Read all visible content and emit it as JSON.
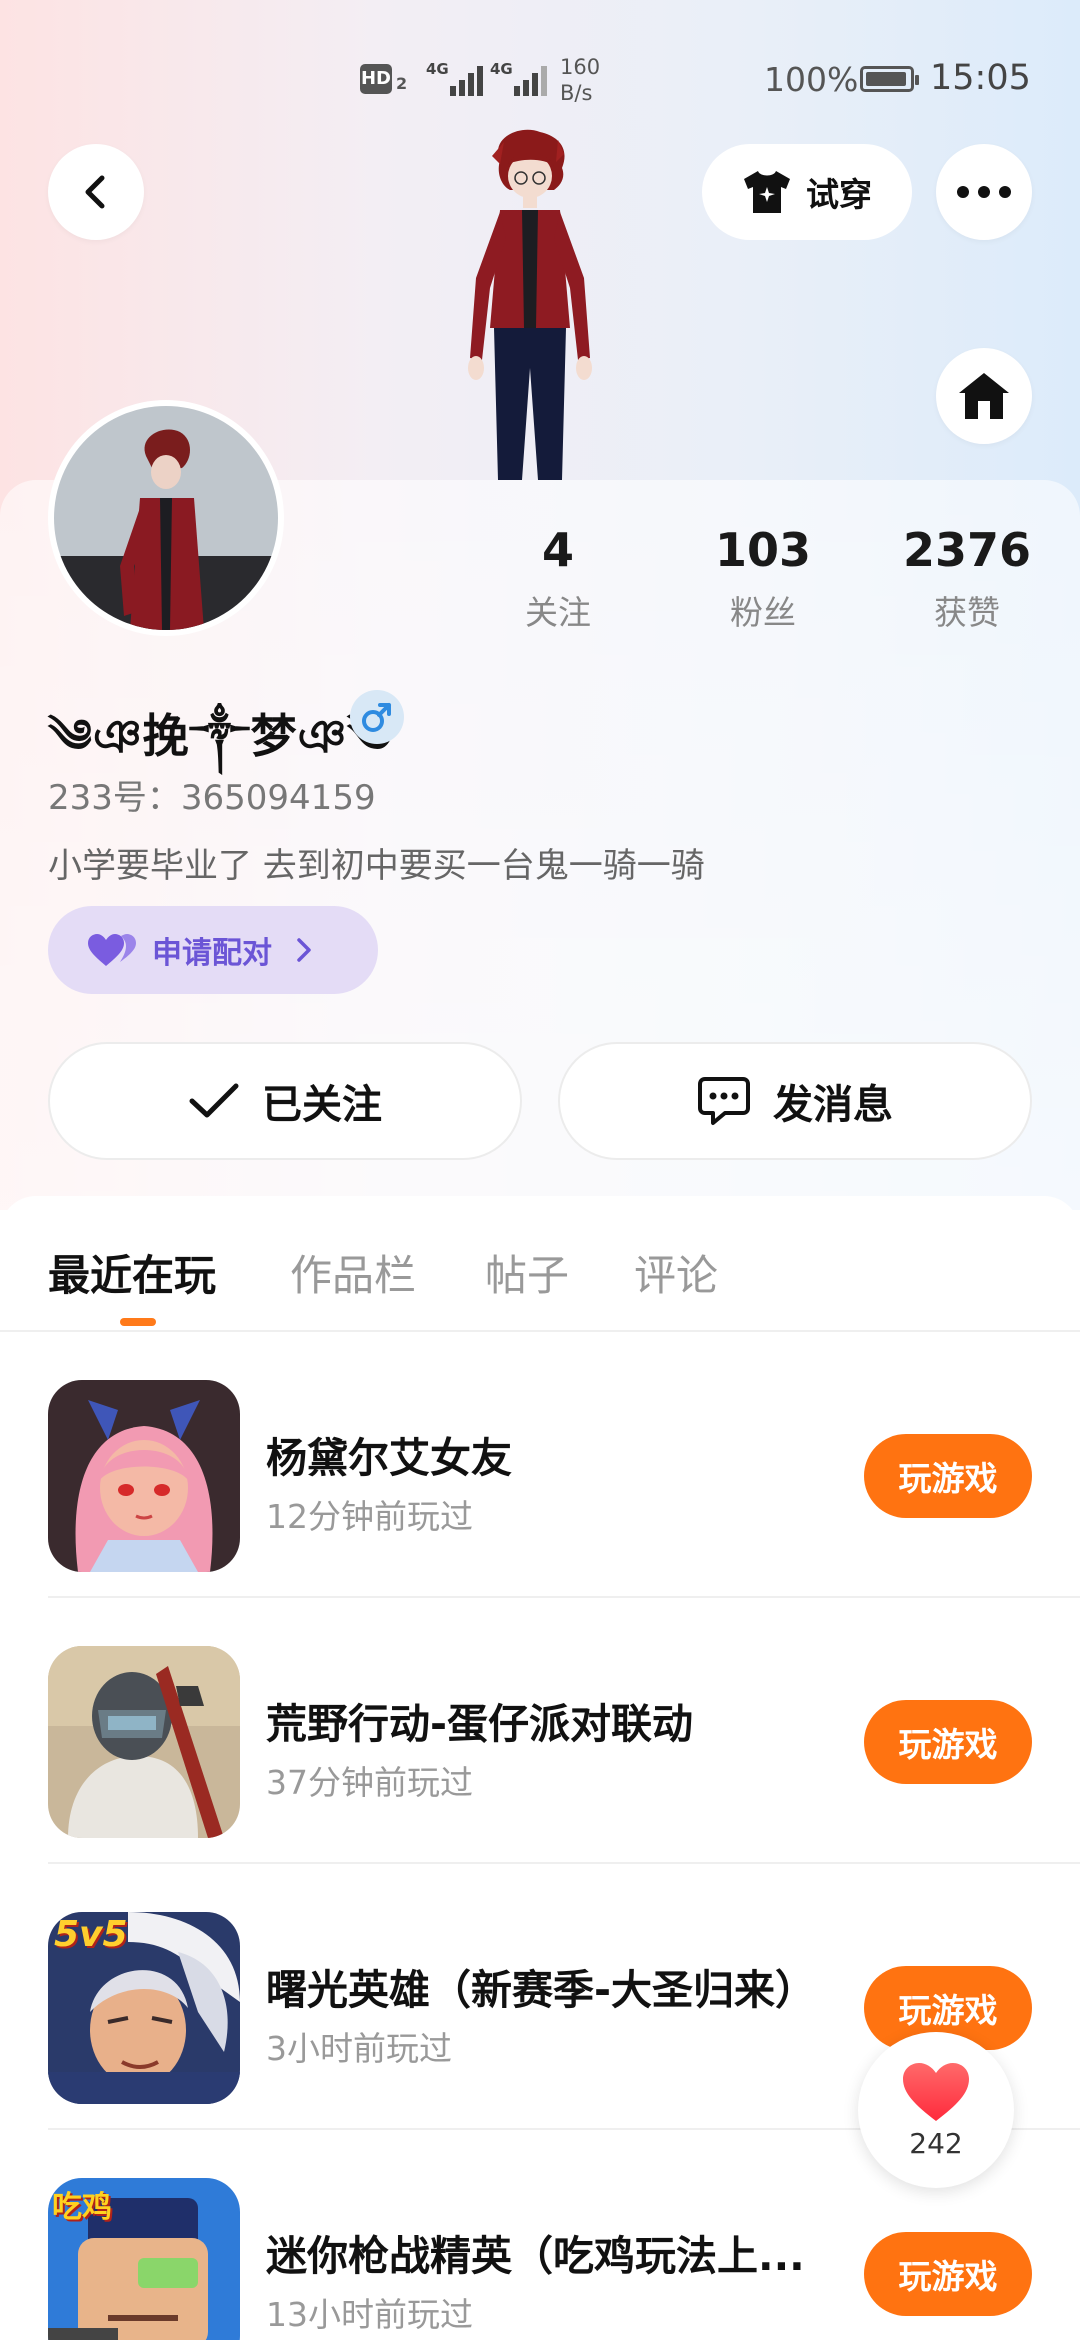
{
  "status_bar": {
    "hd": "HD",
    "hd_sub": "2",
    "net1": "4G",
    "net2": "4G",
    "speed_value": "160",
    "speed_unit": "B/s",
    "battery": "100%",
    "time": "15:05"
  },
  "header": {
    "back_icon": "chevron-left-icon",
    "try_on_label": "试穿",
    "try_on_icon": "shirt-icon",
    "more_icon": "more-dots-icon",
    "home_icon": "house-icon"
  },
  "profile": {
    "stats": [
      {
        "value": "4",
        "label": "关注"
      },
      {
        "value": "103",
        "label": "粉丝"
      },
      {
        "value": "2376",
        "label": "获赞"
      }
    ],
    "nickname": "༄ঞ挽༒梦ঞ༄",
    "gender_icon": "male-icon",
    "uid": "233号：365094159",
    "bio": "小学要毕业了 去到初中要买一台鬼一骑一骑",
    "pair_label": "申请配对",
    "followed_label": "已关注",
    "message_label": "发消息"
  },
  "tabs": [
    {
      "label": "最近在玩",
      "active": true
    },
    {
      "label": "作品栏",
      "active": false
    },
    {
      "label": "帖子",
      "active": false
    },
    {
      "label": "评论",
      "active": false
    }
  ],
  "games": [
    {
      "title": "杨黛尔艾女友",
      "time": "12分钟前玩过",
      "button": "玩游戏"
    },
    {
      "title": "荒野行动-蛋仔派对联动",
      "time": "37分钟前玩过",
      "button": "玩游戏"
    },
    {
      "title": "曙光英雄（新赛季-大圣归来）",
      "time": "3小时前玩过",
      "button": "玩游戏"
    },
    {
      "title": "迷你枪战精英（吃鸡玩法上...",
      "time": "13小时前玩过",
      "button": "玩游戏"
    }
  ],
  "game_icon_text": {
    "g3": "5v5",
    "g4": "吃鸡"
  },
  "floating_like": {
    "count": "242",
    "icon": "heart-icon"
  },
  "colors": {
    "accent": "#ff7311",
    "pair_bg": "#e4dcf6",
    "pair_text": "#6b55d6",
    "tab_indicator": "#ff7a1a",
    "like_heart": "#ff3b4a"
  }
}
